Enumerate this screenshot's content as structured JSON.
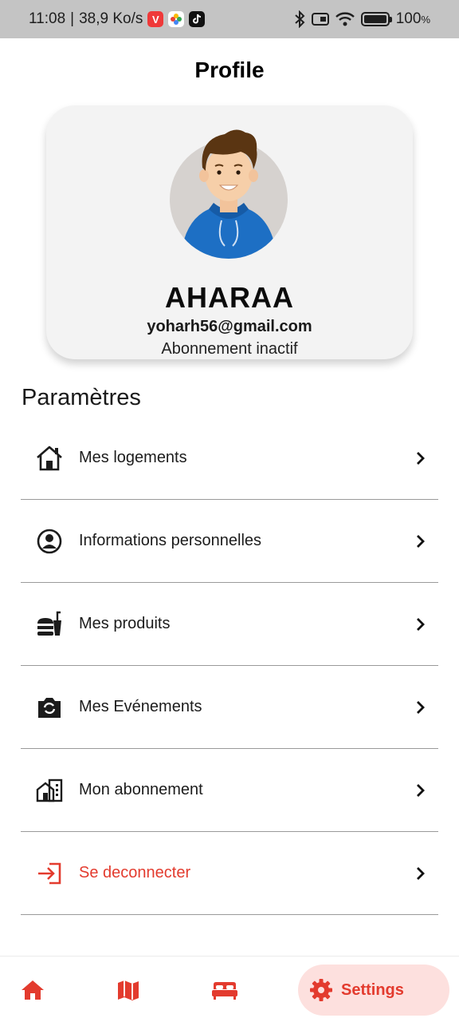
{
  "status_bar": {
    "time": "11:08",
    "speed": "38,9 Ko/s",
    "battery_value": "100",
    "battery_unit": "%"
  },
  "header": {
    "title": "Profile"
  },
  "profile": {
    "name": "AHARAA",
    "email": "yoharh56@gmail.com",
    "subscription_status": "Abonnement inactif"
  },
  "settings": {
    "section_title": "Paramètres",
    "items": [
      {
        "label": "Mes logements",
        "icon": "house-icon"
      },
      {
        "label": "Informations personnelles",
        "icon": "account-circle-icon"
      },
      {
        "label": "Mes produits",
        "icon": "fastfood-icon"
      },
      {
        "label": "Mes Evénements",
        "icon": "camera-switch-icon"
      },
      {
        "label": "Mon abonnement",
        "icon": "apartment-icon"
      },
      {
        "label": "Se deconnecter",
        "icon": "logout-icon"
      }
    ]
  },
  "bottom_nav": {
    "items": [
      {
        "icon": "home-icon"
      },
      {
        "icon": "map-icon"
      },
      {
        "icon": "bed-icon"
      }
    ],
    "active": {
      "label": "Settings",
      "icon": "gear-icon"
    }
  },
  "colors": {
    "accent": "#e33b2e",
    "active_pill": "#fde0de",
    "card_background": "#f3f3f3"
  }
}
